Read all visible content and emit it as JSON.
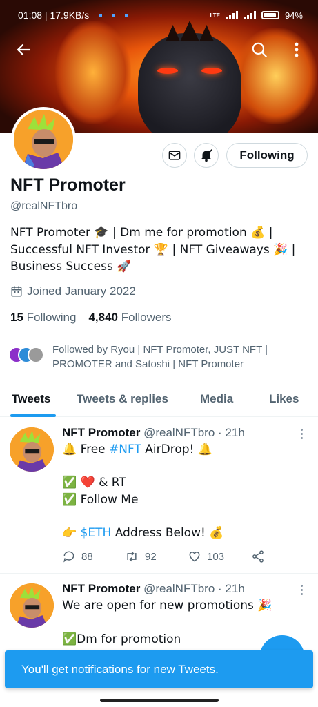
{
  "status_bar": {
    "time_speed": "01:08 | 17.9KB/s",
    "network": "LTE",
    "battery": "94%"
  },
  "profile": {
    "name": "NFT Promoter",
    "handle": "@realNFTbro",
    "bio_lines": [
      "NFT Promoter 🎓 | Dm me for promotion 💰 |",
      "Successful NFT Investor 🏆 | NFT Giveaways 🎉 |",
      "Business Success 🚀"
    ],
    "joined": "Joined January 2022",
    "following_count": "15",
    "following_label": "Following",
    "followers_count": "4,840",
    "followers_label": "Followers",
    "followed_by_lines": [
      "Followed by Ryou | NFT Promoter, JUST NFT |",
      "PROMOTER and Satoshi | NFT Promoter"
    ],
    "following_button": "Following"
  },
  "tabs": [
    "Tweets",
    "Tweets & replies",
    "Media",
    "Likes"
  ],
  "tweets": [
    {
      "name": "NFT Promoter",
      "meta": "@realNFTbro · 21h",
      "lines": {
        "l1_pre": "🔔 Free ",
        "l1_link": "#NFT",
        "l1_post": " AirDrop! 🔔",
        "l2": "✅ ❤️ & RT",
        "l3": "✅ Follow Me",
        "l4_pre": "👉 ",
        "l4_link": "$ETH",
        "l4_post": " Address Below! 💰"
      },
      "replies": "88",
      "retweets": "92",
      "likes": "103"
    },
    {
      "name": "NFT Promoter",
      "meta": "@realNFTbro · 21h",
      "lines": {
        "l1": "We are open for new promotions 🎉",
        "l2": "✅Dm for promotion"
      }
    }
  ],
  "toast": "You'll get notifications for new Tweets.",
  "colors": {
    "accent": "#1d9bf0",
    "text": "#0f1419",
    "muted": "#536471"
  },
  "icons": [
    "back-arrow-icon",
    "search-icon",
    "more-vertical-icon",
    "mail-icon",
    "bell-check-icon",
    "calendar-icon",
    "reply-icon",
    "retweet-icon",
    "heart-icon",
    "share-icon"
  ]
}
